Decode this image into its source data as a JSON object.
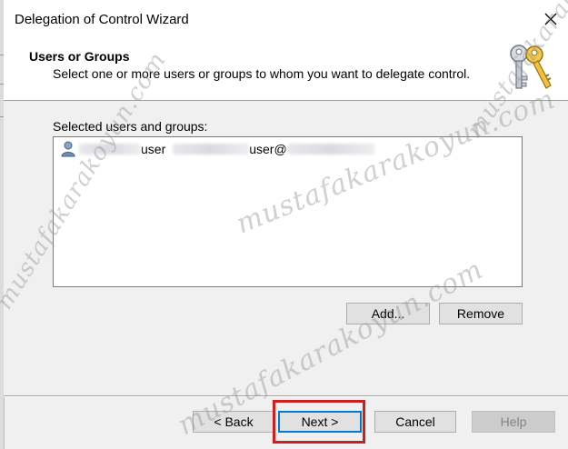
{
  "window": {
    "title": "Delegation of Control Wizard",
    "close_icon": "close-icon"
  },
  "header": {
    "title": "Users or Groups",
    "subtitle": "Select one or more users or groups to whom you want to delegate control.",
    "icon": "keys-icon"
  },
  "selection": {
    "label": "Selected users and groups:",
    "items": [
      {
        "icon": "user-icon",
        "name_suffix": "user",
        "upn_suffix": "user@"
      }
    ]
  },
  "actions": {
    "add_label": "Add...",
    "remove_label": "Remove"
  },
  "footer": {
    "back_label": "< Back",
    "next_label": "Next >",
    "cancel_label": "Cancel",
    "help_label": "Help"
  },
  "watermark": {
    "text_1": "mustafakarakoyun.com",
    "text_2": "mustafakarakoyun.com",
    "text_3": "mustafakarakoyun.com",
    "text_4": "mustafakarakoyun.com"
  },
  "colors": {
    "accent": "#0078d7",
    "highlight": "#cc1f1f",
    "dialog_bg": "#f0f0f0"
  }
}
